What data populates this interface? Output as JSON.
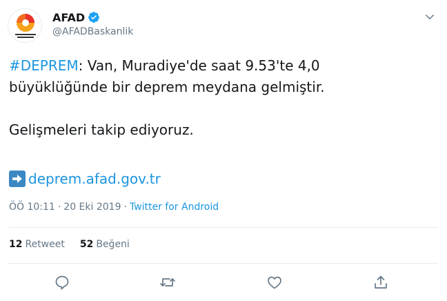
{
  "user": {
    "display_name": "AFAD",
    "handle": "@AFADBaskanlik",
    "avatar_icon": "afad-logo-icon",
    "verified_icon": "verified-badge-icon"
  },
  "tweet": {
    "hashtag": "#DEPREM",
    "line1_rest": ": Van, Muradiye'de saat 9.53'te 4,0",
    "line2": "büyüklüğünde bir deprem meydana gelmiştir.",
    "line3": "Gelişmeleri takip ediyoruz.",
    "link_icon": "right-arrow-emoji-icon",
    "link_text": "deprem.afad.gov.tr"
  },
  "meta": {
    "time": "ÖÖ 10:11",
    "separator": "·",
    "date": "20 Eki 2019",
    "source": "Twitter for Android"
  },
  "stats": {
    "retweets_count": "12",
    "retweets_label": "Retweet",
    "likes_count": "52",
    "likes_label": "Beğeni"
  },
  "actions": [
    "reply-icon",
    "retweet-icon",
    "like-icon",
    "share-icon"
  ],
  "colors": {
    "link": "#1b95e0",
    "secondary_text": "#657786",
    "primary_text": "#14171a",
    "divider": "#e6ecf0",
    "verified": "#1da1f2"
  }
}
